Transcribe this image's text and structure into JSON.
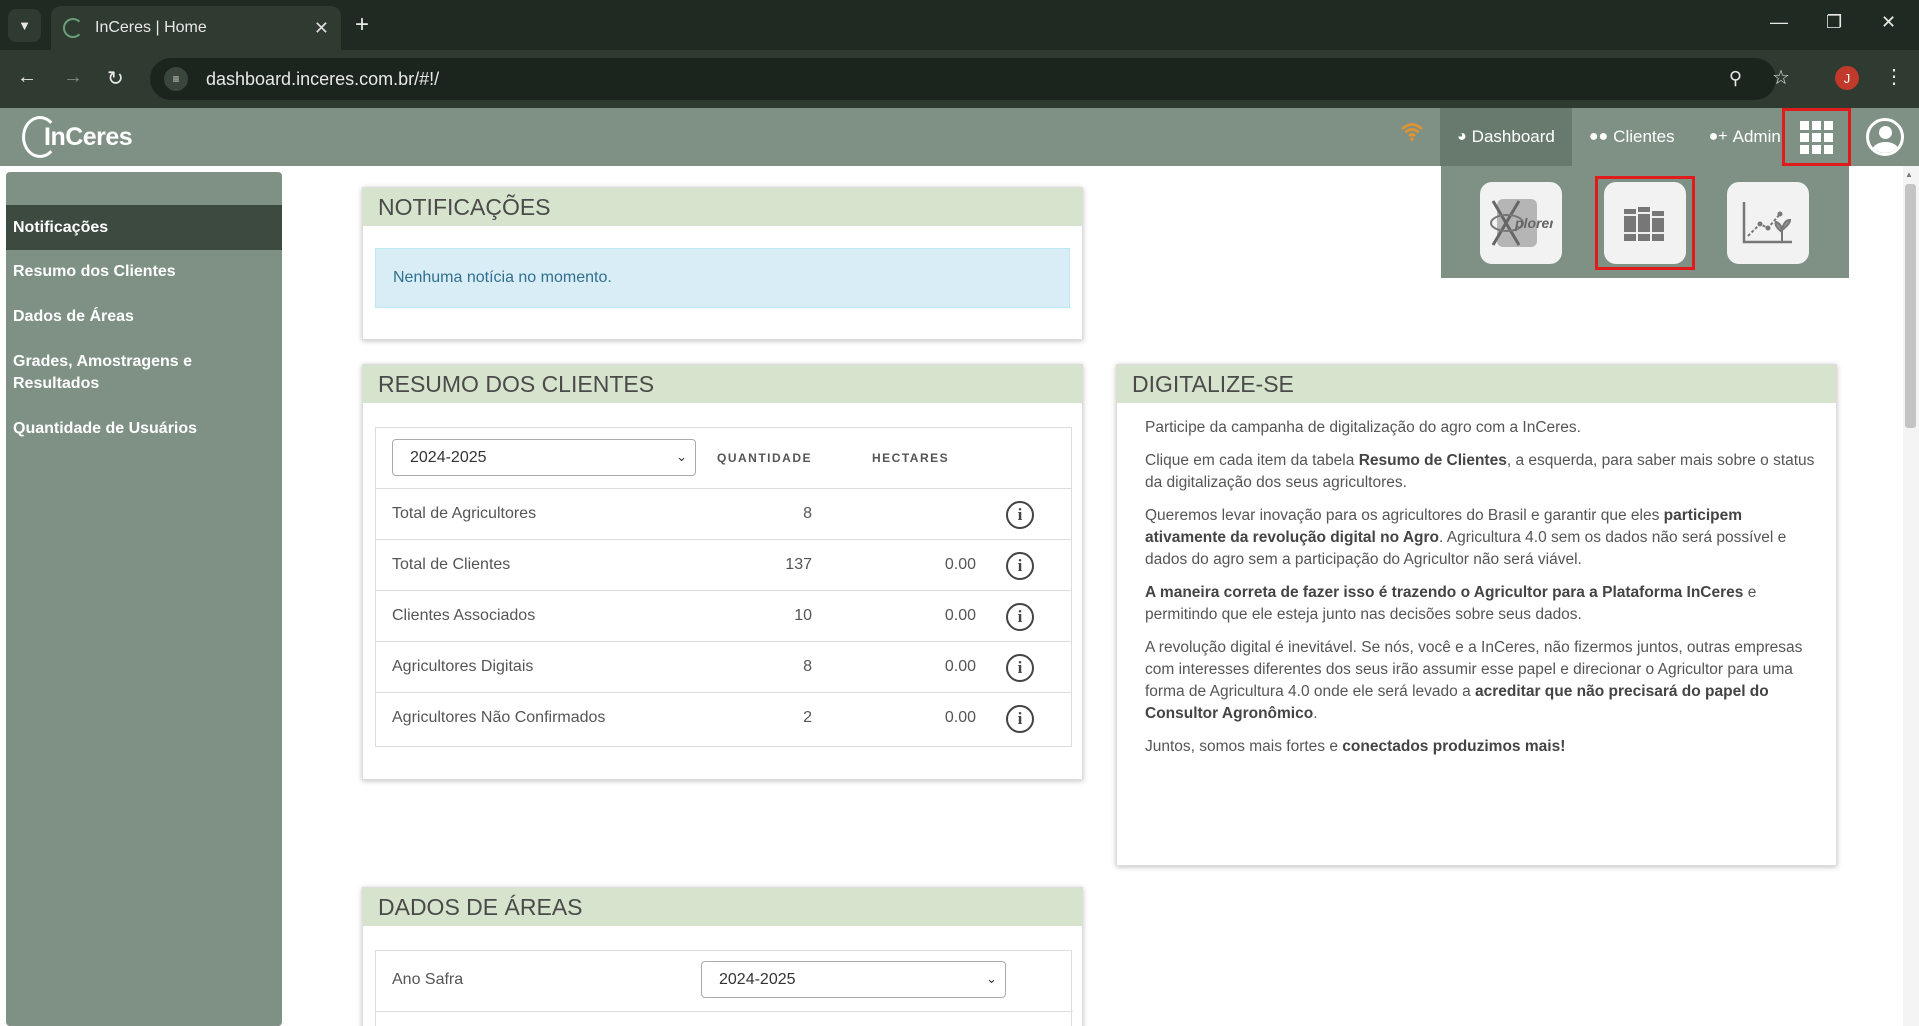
{
  "browser": {
    "tab_title": "InCeres | Home",
    "url": "dashboard.inceres.com.br/#!/",
    "profile_initial": "J"
  },
  "app": {
    "logo": "InCeres",
    "nav": [
      {
        "label": "Dashboard",
        "icon": "dashboard-icon",
        "active": true
      },
      {
        "label": "Clientes",
        "icon": "users-icon",
        "active": false
      },
      {
        "label": "Admin",
        "icon": "user-plus-icon",
        "active": false
      }
    ],
    "apps": [
      {
        "name": "xplorer",
        "label": "plorer",
        "icon": "xplorer-app-icon"
      },
      {
        "name": "library",
        "icon": "books-app-icon",
        "highlighted": true
      },
      {
        "name": "analytics",
        "icon": "chart-plant-app-icon"
      }
    ],
    "highlight_color": "#e01b1b"
  },
  "sidebar": {
    "items": [
      {
        "label": "Notificações",
        "active": true
      },
      {
        "label": "Resumo dos Clientes"
      },
      {
        "label": "Dados de Áreas"
      },
      {
        "label": "Grades, Amostragens e Resultados"
      },
      {
        "label": "Quantidade de Usuários"
      }
    ]
  },
  "notificacoes": {
    "title": "NOTIFICAÇÕES",
    "message": "Nenhuma notícia no momento."
  },
  "resumo": {
    "title": "RESUMO DOS CLIENTES",
    "season": "2024-2025",
    "col_quantidade": "QUANTIDADE",
    "col_hectares": "HECTARES",
    "rows": [
      {
        "label": "Total de Agricultores",
        "quantidade": "8",
        "hectares": ""
      },
      {
        "label": "Total de Clientes",
        "quantidade": "137",
        "hectares": "0.00"
      },
      {
        "label": "Clientes Associados",
        "quantidade": "10",
        "hectares": "0.00"
      },
      {
        "label": "Agricultores Digitais",
        "quantidade": "8",
        "hectares": "0.00"
      },
      {
        "label": "Agricultores Não Confirmados",
        "quantidade": "2",
        "hectares": "0.00"
      }
    ]
  },
  "digitalize": {
    "title": "DIGITALIZE-SE",
    "p1": "Participe da campanha de digitalização do agro com a InCeres.",
    "p2a": "Clique em cada item da tabela ",
    "p2b": "Resumo de Clientes",
    "p2c": ", a esquerda, para saber mais sobre o status da digitalização dos seus agricultores.",
    "p3a": "Queremos levar inovação para os agricultores do Brasil e garantir que eles ",
    "p3b": "participem ativamente da revolução digital no Agro",
    "p3c": ". Agricultura 4.0 sem os dados não será possível e dados do agro sem a participação do Agricultor não será viável.",
    "p4a": "A maneira correta de fazer isso é trazendo o Agricultor para a Plataforma InCeres",
    "p4b": " e permitindo que ele esteja junto nas decisões sobre seus dados.",
    "p5a": "A revolução digital é inevitável. Se nós, você e a InCeres, não fizermos juntos, outras empresas com interesses diferentes dos seus irão assumir esse papel e direcionar o Agricultor para uma forma de Agricultura 4.0 onde ele será levado a ",
    "p5b": "acreditar que não precisará do papel do Consultor Agronômico",
    "p5c": ".",
    "p6a": "Juntos, somos mais fortes e ",
    "p6b": "conectados produzimos mais!"
  },
  "dados_areas": {
    "title": "DADOS DE ÁREAS",
    "ano_safra_label": "Ano Safra",
    "season": "2024-2025"
  }
}
